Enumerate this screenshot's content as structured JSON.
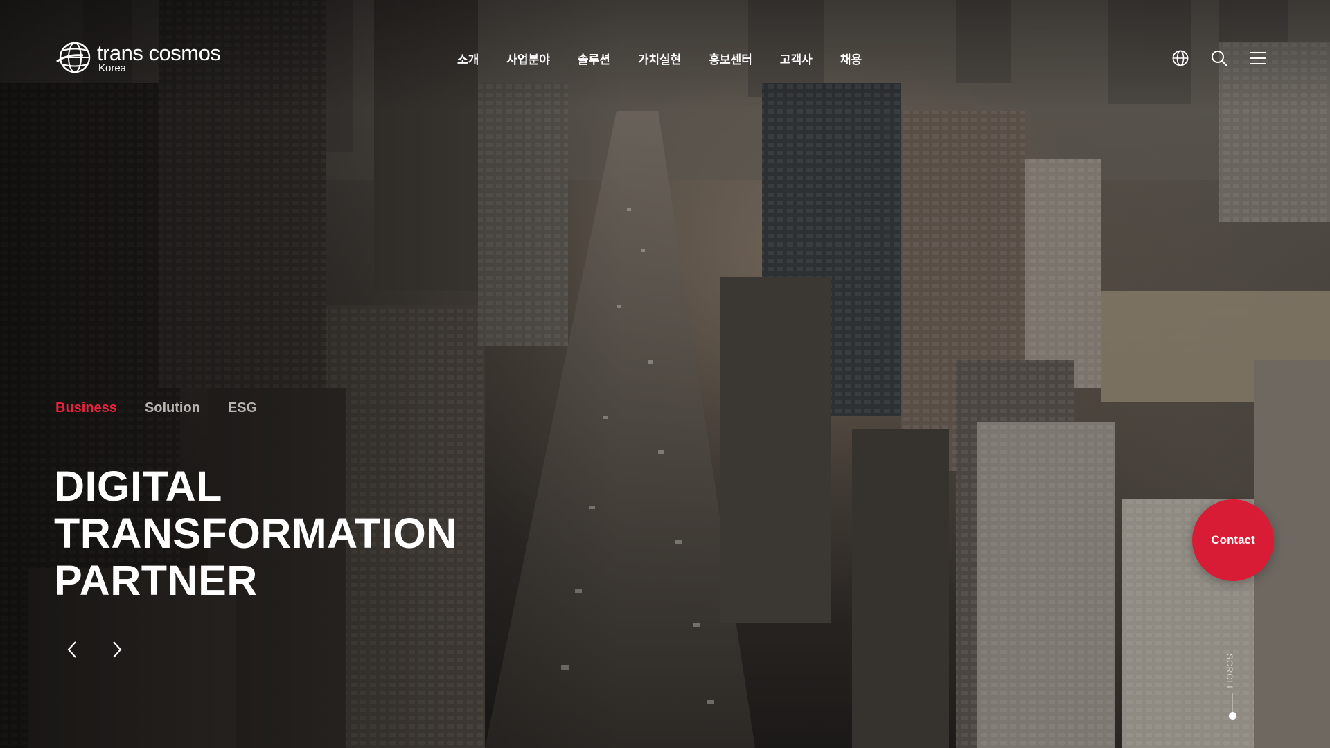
{
  "brand": {
    "name": "trans cosmos",
    "sub": "Korea"
  },
  "nav": {
    "items": [
      {
        "label": "소개"
      },
      {
        "label": "사업분야"
      },
      {
        "label": "솔루션"
      },
      {
        "label": "가치실현"
      },
      {
        "label": "홍보센터"
      },
      {
        "label": "고객사"
      },
      {
        "label": "채용"
      }
    ]
  },
  "header_icons": [
    "globe-icon",
    "search-icon",
    "menu-icon"
  ],
  "hero": {
    "tabs": [
      {
        "label": "Business",
        "active": true
      },
      {
        "label": "Solution",
        "active": false
      },
      {
        "label": "ESG",
        "active": false
      }
    ],
    "headline": {
      "line1": "DIGITAL",
      "line2": "TRANSFORMATION",
      "line3": "PARTNER"
    },
    "prev_icon": "chevron-left-icon",
    "next_icon": "chevron-right-icon"
  },
  "contact": {
    "label": "Contact"
  },
  "scroll": {
    "label": "SCROLL"
  },
  "colors": {
    "accent": "#d81c35",
    "active_tab": "#e8233d",
    "inactive_tab": "#b8b4af",
    "text": "#ffffff"
  }
}
